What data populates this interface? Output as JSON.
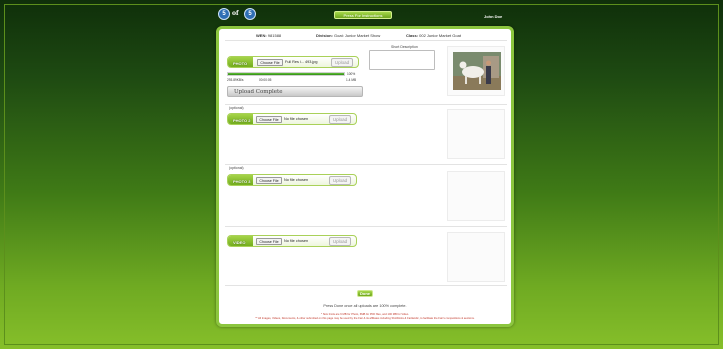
{
  "header": {
    "current_step": "5",
    "of_label": "of",
    "total_steps": "5",
    "instructions_label": "Press For Instructions",
    "user_name": "John Doe"
  },
  "entry": {
    "wen_label": "WEN:",
    "wen_value": "981588",
    "division_label": "Division:",
    "division_value": "Goat: Junior Market Show",
    "class_label": "Class:",
    "class_value": "002 Junior Market Goat"
  },
  "photo": {
    "tag": "PHOTO",
    "choose_label": "Choose File",
    "file_name": "Full Res i... 493.jpg",
    "upload_label": "Upload",
    "progress_percent": 100,
    "progress_percent_label": "100%",
    "bytes_label": "293.89KB/s",
    "time_label": "00:00:05",
    "size_label": "1.4 MB",
    "status_label": "Upload Complete",
    "description_label": "Short Description"
  },
  "photo2": {
    "optional_label": "(optional)",
    "tag": "PHOTO 2",
    "choose_label": "Choose File",
    "file_name": "No file chosen",
    "upload_label": "Upload"
  },
  "photo3": {
    "optional_label": "(optional)",
    "tag": "PHOTO 3",
    "choose_label": "Choose File",
    "file_name": "No file chosen",
    "upload_label": "Upload"
  },
  "video": {
    "tag": "VIDEO",
    "choose_label": "Choose File",
    "file_name": "No file chosen",
    "upload_label": "Upload"
  },
  "footer": {
    "done_label": "Done",
    "done_note": "Press Done once all uploads are 100% complete.",
    "fine_print_1": "* Size limits are 6 MB for Photo, 6MB for PDF files, and 100 MB for Video.",
    "fine_print_2": "** All Images, Videos, Documents, & other submitted on this page may be used by the Fair & its affiliates including ShoWorks & Fairlandic, to facilitate the Fair's competitions & auctions."
  },
  "colors": {
    "accent_green": "#8cc63f",
    "badge_blue": "#2f6fb5",
    "progress_green": "#3a9a1c",
    "fine_print_red": "#c0392b"
  }
}
